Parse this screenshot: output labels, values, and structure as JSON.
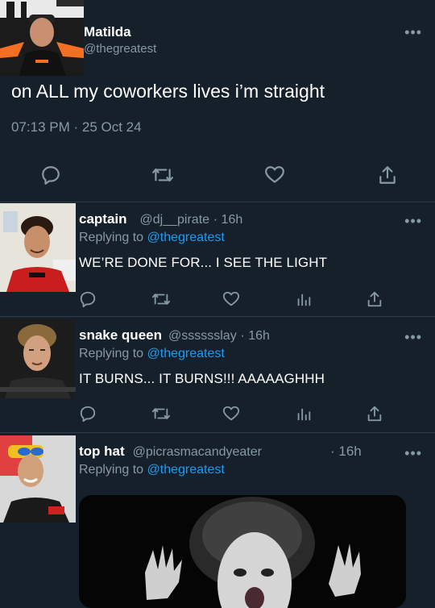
{
  "main": {
    "name": "Matilda",
    "handle": "@thegreatest",
    "text": "on ALL my coworkers lives i’m straight",
    "timestamp": "07:13 PM · 25 Oct 24",
    "more_label": "•••"
  },
  "replies": [
    {
      "name": "captain",
      "handle": "@dj__pirate",
      "time": "· 16h",
      "replying_prefix": "Replying to",
      "replying_to": "@thegreatest",
      "text": "WE’RE DONE FOR... I SEE THE LIGHT",
      "more_label": "•••"
    },
    {
      "name": "snake queen",
      "handle": "@sssssslay",
      "time": "· 16h",
      "replying_prefix": "Replying to",
      "replying_to": "@thegreatest",
      "text": "IT BURNS... IT BURNS!!! AAAAAGHHH",
      "more_label": "•••"
    },
    {
      "name": "top hat",
      "handle": "@picrasmacandyeater",
      "time": "· 16h",
      "replying_prefix": "Replying to",
      "replying_to": "@thegreatest",
      "text": "",
      "more_label": "•••"
    }
  ],
  "colors": {
    "background": "#15202b",
    "accent": "#1d9bf0",
    "muted": "#8899a6"
  },
  "icons": [
    "reply-icon",
    "retweet-icon",
    "like-icon",
    "share-icon",
    "analytics-icon",
    "more-icon"
  ]
}
